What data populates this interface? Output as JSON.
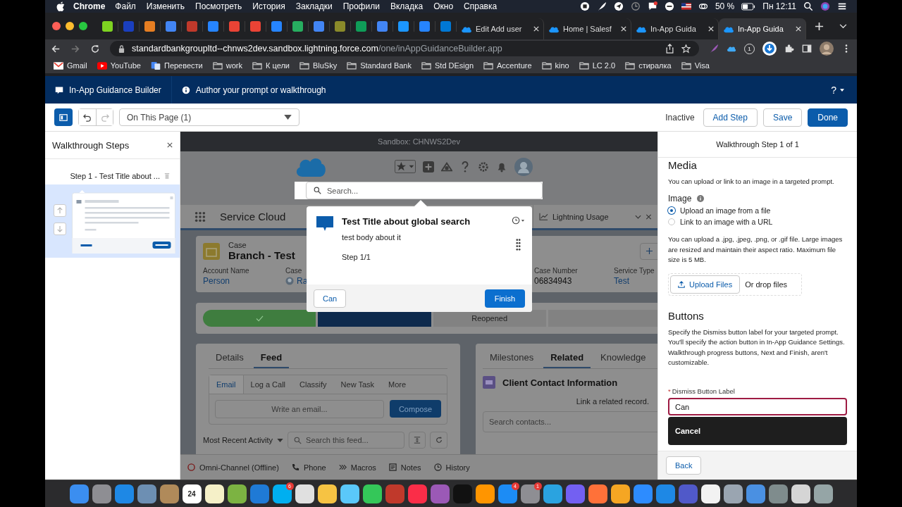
{
  "menu_bar": {
    "app": "Chrome",
    "items": [
      "Файл",
      "Изменить",
      "Посмотреть",
      "История",
      "Закладки",
      "Профили",
      "Вкладка",
      "Окно",
      "Справка"
    ],
    "battery": "50 %",
    "clock": "Пн 12:11"
  },
  "browser": {
    "pinned_tabs": [
      {
        "color": "#7ed321"
      },
      {
        "color": "#1a3fbf"
      },
      {
        "color": "#e67e22"
      },
      {
        "color": "#4285f4"
      },
      {
        "color": "#c0392b"
      },
      {
        "color": "#2684ff"
      },
      {
        "color": "#ea4335"
      },
      {
        "color": "#ea4335"
      },
      {
        "color": "#2684ff"
      },
      {
        "color": "#27ae60"
      },
      {
        "color": "#4285f4"
      },
      {
        "color": "#8a8a2a"
      },
      {
        "color": "#0f9d58"
      },
      {
        "color": "#4285f4"
      },
      {
        "color": "#1b96ff"
      },
      {
        "color": "#2684ff"
      },
      {
        "color": "#0078d4"
      }
    ],
    "tabs": [
      {
        "label": "Edit Add user",
        "selected": false
      },
      {
        "label": "Home | Salesf",
        "selected": false
      },
      {
        "label": "In-App Guida",
        "selected": false
      },
      {
        "label": "In-App Guida",
        "selected": true
      }
    ],
    "url_host": "standardbankgroupltd--chnws2dev.sandbox.lightning.force.com",
    "url_path": "/one/inAppGuidanceBuilder.app",
    "extension_badge": "1",
    "bookmarks": [
      {
        "label": "Gmail",
        "kind": "gmail"
      },
      {
        "label": "YouTube",
        "kind": "youtube"
      },
      {
        "label": "Перевести",
        "kind": "translate"
      },
      {
        "label": "work",
        "kind": "folder"
      },
      {
        "label": "К цели",
        "kind": "folder"
      },
      {
        "label": "BluSky",
        "kind": "folder"
      },
      {
        "label": "Standard Bank",
        "kind": "folder"
      },
      {
        "label": "Std DEsign",
        "kind": "folder"
      },
      {
        "label": "Accenture",
        "kind": "folder"
      },
      {
        "label": "kino",
        "kind": "folder"
      },
      {
        "label": "LC 2.0",
        "kind": "folder"
      },
      {
        "label": "стиралка",
        "kind": "folder"
      },
      {
        "label": "Visa",
        "kind": "folder"
      }
    ]
  },
  "builder_header": {
    "title": "In-App Guidance Builder",
    "subtitle": "Author your prompt or walkthrough",
    "help": "?"
  },
  "toolbar": {
    "page_filter": "On This Page (1)",
    "status": "Inactive",
    "buttons": [
      {
        "label": "Add Step",
        "kind": "neutral"
      },
      {
        "label": "Save",
        "kind": "neutral"
      },
      {
        "label": "Done",
        "kind": "brand"
      }
    ]
  },
  "steps_panel": {
    "title": "Walkthrough Steps",
    "steps": [
      {
        "label": "Step 1 - Test Title about ...",
        "selected": true
      }
    ]
  },
  "preview": {
    "sandbox_label": "Sandbox: CHNWS2Dev",
    "search_placeholder": "Search...",
    "app_name": "Service Cloud",
    "nav_tab": "Lightning Usage",
    "record": {
      "type": "Case",
      "title": "Branch - Test",
      "fields": [
        {
          "label": "Account Name",
          "value": "Person",
          "link": true
        },
        {
          "label": "Case",
          "value": "Ra",
          "link": true
        },
        {
          "label": "Case Number",
          "value": "06834943",
          "link": false
        },
        {
          "label": "Service Type",
          "value": "Test",
          "link": true
        }
      ]
    },
    "path": [
      {
        "complete": true,
        "current": false
      },
      {
        "complete": false,
        "current": true
      },
      {
        "complete": false,
        "current": false,
        "label": "Reopened"
      },
      {
        "complete": false,
        "current": false
      }
    ],
    "feed_tabs": [
      {
        "label": "Details",
        "selected": false
      },
      {
        "label": "Feed",
        "selected": true
      }
    ],
    "publisher_tabs": [
      {
        "label": "Email",
        "selected": true
      },
      {
        "label": "Log a Call",
        "selected": false
      },
      {
        "label": "Classify",
        "selected": false
      },
      {
        "label": "New Task",
        "selected": false
      },
      {
        "label": "More",
        "selected": false
      }
    ],
    "email_placeholder": "Write an email...",
    "compose": "Compose",
    "sort": "Most Recent Activity",
    "feed_search_placeholder": "Search this feed...",
    "side_tabs": [
      {
        "label": "Milestones",
        "selected": false
      },
      {
        "label": "Related",
        "selected": true
      },
      {
        "label": "Knowledge",
        "selected": false
      }
    ],
    "related_title": "Client Contact Information",
    "related_link": "Link a related record.",
    "contacts_placeholder": "Search contacts...",
    "utility_bar": [
      {
        "label": "Omni-Channel (Offline)",
        "kind": "omni"
      },
      {
        "label": "Phone",
        "kind": "phone"
      },
      {
        "label": "Macros",
        "kind": "macros"
      },
      {
        "label": "Notes",
        "kind": "notes"
      },
      {
        "label": "History",
        "kind": "history"
      }
    ]
  },
  "prompt": {
    "title": "Test Title about global search",
    "body": "test body about it",
    "step": "Step 1/1",
    "dismiss": "Can",
    "finish": "Finish"
  },
  "properties": {
    "header": "Walkthrough Step 1 of 1",
    "media_title": "Media",
    "media_desc": "You can upload or link to an image in a targeted prompt.",
    "image_label": "Image",
    "image_options": [
      {
        "label": "Upload an image from a file",
        "selected": true
      },
      {
        "label": "Link to an image with a URL",
        "selected": false
      }
    ],
    "file_note": "You can upload a .jpg, .jpeg, .png, or .gif file. Large images are resized and maintain their aspect ratio. Maximum file size is 5 MB.",
    "upload_button": "Upload Files",
    "drop_text": "Or drop files",
    "buttons_title": "Buttons",
    "buttons_desc": "Specify the Dismiss button label for your targeted prompt. You'll specify the action button in In-App Guidance Settings. Walkthrough progress buttons, Next and Finish, aren't customizable.",
    "dismiss_label": "Dismiss Button Label",
    "required_mark": "*",
    "dismiss_value": "Can",
    "suggestions": [
      "Cancel"
    ],
    "back": "Back"
  },
  "dock": [
    {
      "color": "#3b8ef0"
    },
    {
      "color": "#8e8e93"
    },
    {
      "color": "#1e88e5"
    },
    {
      "color": "#6d8fb3"
    },
    {
      "color": "#b08a5a"
    },
    {
      "color": "#ffffff",
      "text": "24"
    },
    {
      "color": "#f5f0c8"
    },
    {
      "color": "#7cb342"
    },
    {
      "color": "#1f7ad6"
    },
    {
      "color": "#00aff0",
      "badge": "6"
    },
    {
      "color": "#e0e0e0"
    },
    {
      "color": "#f6c343"
    },
    {
      "color": "#5ac8fa"
    },
    {
      "color": "#34c759"
    },
    {
      "color": "#c0392b"
    },
    {
      "color": "#fa2d48"
    },
    {
      "color": "#9b59b6"
    },
    {
      "color": "#111111"
    },
    {
      "color": "#ff9500"
    },
    {
      "color": "#1c8cf5",
      "badge": "4"
    },
    {
      "color": "#8e8e93",
      "badge": "1"
    },
    {
      "color": "#2aa3e0"
    },
    {
      "color": "#7360f2"
    },
    {
      "color": "#ff7139"
    },
    {
      "color": "#f5a623"
    },
    {
      "color": "#2d8cff"
    },
    {
      "color": "#1e88e5"
    },
    {
      "color": "#5059c9"
    },
    {
      "color": "#f2f2f2"
    },
    {
      "color": "#9aa5b1"
    },
    {
      "color": "#4a90e2"
    },
    {
      "color": "#7f8c8d"
    },
    {
      "color": "#d5d5d5"
    },
    {
      "color": "#95a5a6"
    }
  ]
}
